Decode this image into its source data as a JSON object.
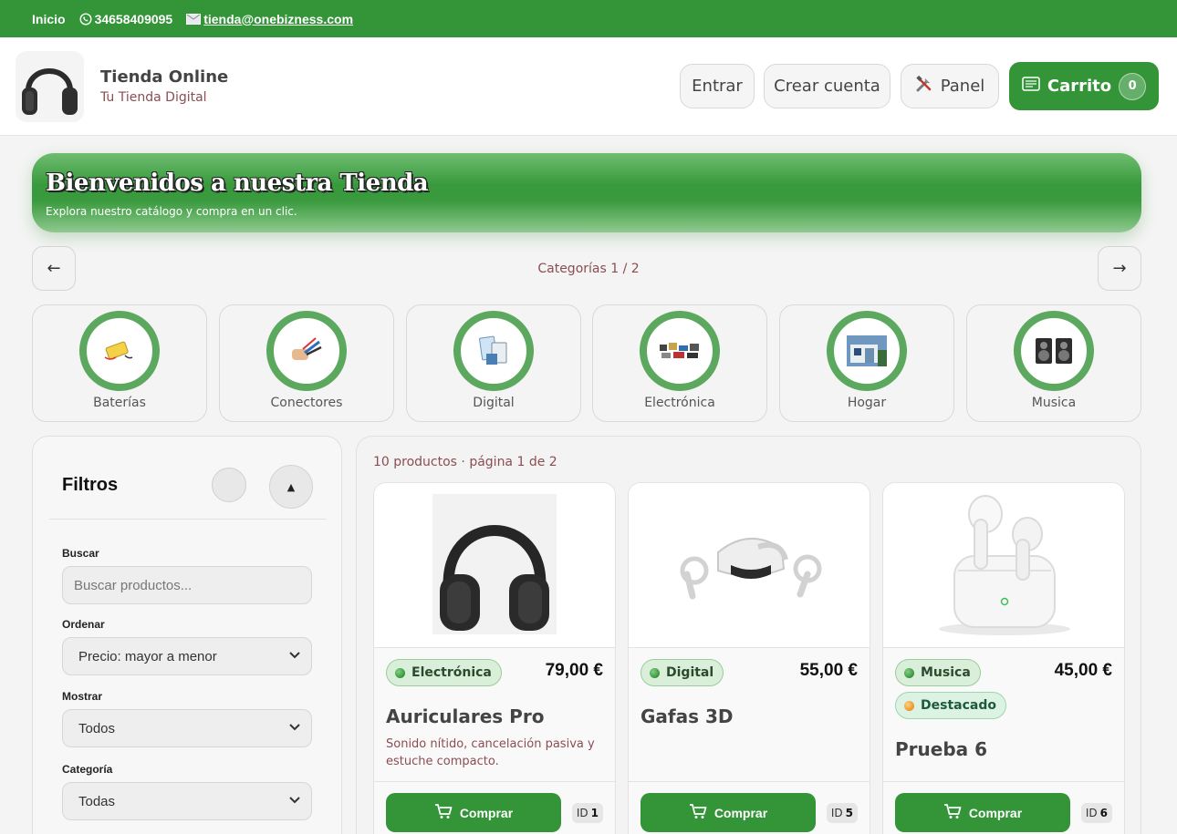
{
  "topbar": {
    "home": "Inicio",
    "phone": "34658409095",
    "email": "tienda@onebizness.com"
  },
  "brand": {
    "title": "Tienda Online",
    "subtitle": "Tu Tienda Digital"
  },
  "header_actions": {
    "login": "Entrar",
    "register": "Crear cuenta",
    "panel": "Panel",
    "cart": "Carrito",
    "cart_count": "0"
  },
  "hero": {
    "title": "Bienvenidos a nuestra Tienda",
    "subtitle": "Explora nuestro catálogo y compra en un clic."
  },
  "categories": {
    "pager": "Categorías 1 / 2",
    "prev": "←",
    "next": "→",
    "items": [
      {
        "name": "Baterías",
        "icon": "battery-icon"
      },
      {
        "name": "Conectores",
        "icon": "connector-icon"
      },
      {
        "name": "Digital",
        "icon": "digital-icon"
      },
      {
        "name": "Electrónica",
        "icon": "electronics-icon"
      },
      {
        "name": "Hogar",
        "icon": "home-icon"
      },
      {
        "name": "Musica",
        "icon": "speaker-icon"
      }
    ]
  },
  "filters": {
    "title": "Filtros",
    "search_label": "Buscar",
    "search_placeholder": "Buscar productos...",
    "sort_label": "Ordenar",
    "sort_value": "Precio: mayor a menor",
    "show_label": "Mostrar",
    "show_value": "Todos",
    "category_label": "Categoría",
    "category_value": "Todas"
  },
  "products": {
    "count_text": "10 productos · página 1 de 2",
    "buy_label": "Comprar",
    "id_label": "ID",
    "items": [
      {
        "category": "Electrónica",
        "price": "79,00 €",
        "name": "Auriculares Pro",
        "desc": "Sonido nítido, cancelación pasiva y estuche compacto.",
        "id": "1"
      },
      {
        "category": "Digital",
        "price": "55,00 €",
        "name": "Gafas 3D",
        "desc": "",
        "id": "5"
      },
      {
        "category": "Musica",
        "featured": "Destacado",
        "price": "45,00 €",
        "name": "Prueba 6",
        "desc": "",
        "id": "6"
      }
    ]
  },
  "colors": {
    "primary": "#339438",
    "ring": "#5ba85e",
    "muted_text": "#8b4d52"
  }
}
